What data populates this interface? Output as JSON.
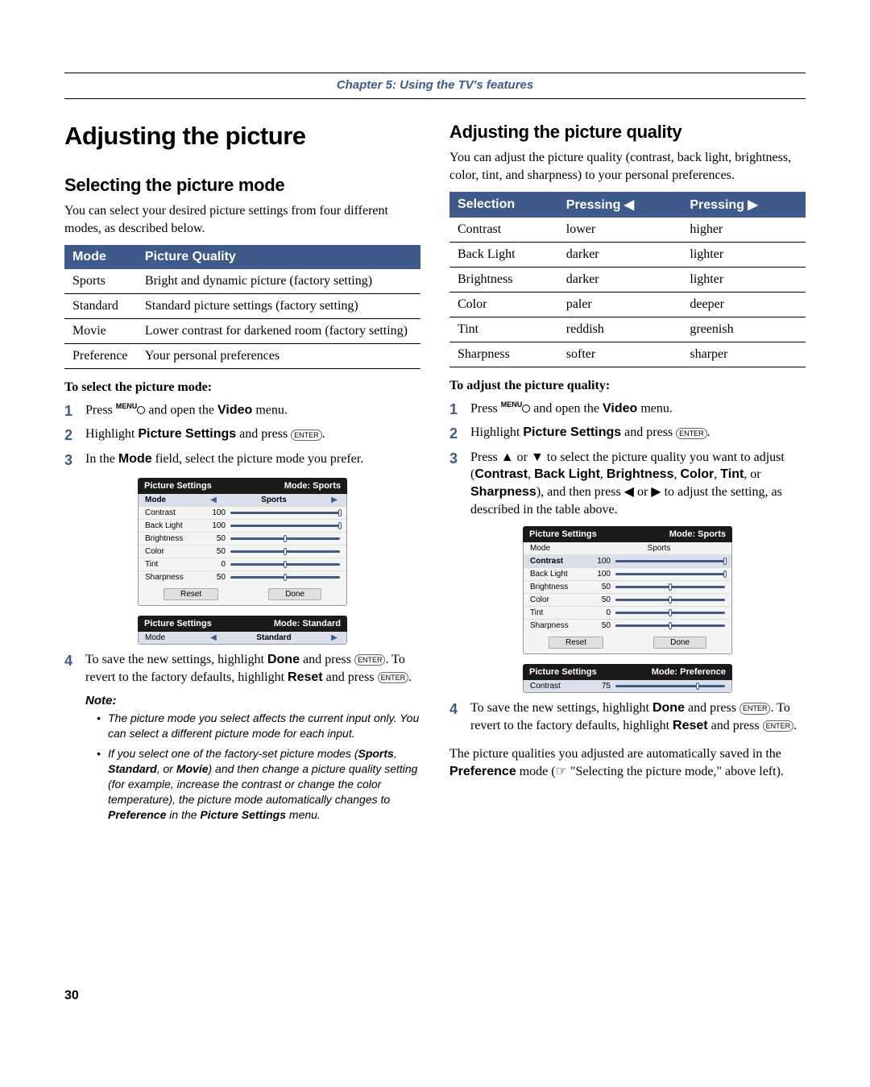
{
  "chapter": "Chapter 5: Using the TV's features",
  "left": {
    "h1": "Adjusting the picture",
    "h2": "Selecting the picture mode",
    "intro": "You can select your desired picture settings from four different modes, as described below.",
    "table": {
      "head1": "Mode",
      "head2": "Picture Quality",
      "rows": [
        {
          "c1": "Sports",
          "c2": "Bright and dynamic picture (factory setting)"
        },
        {
          "c1": "Standard",
          "c2": "Standard picture settings (factory setting)"
        },
        {
          "c1": "Movie",
          "c2": "Lower contrast for darkened room (factory setting)"
        },
        {
          "c1": "Preference",
          "c2": "Your personal preferences"
        }
      ]
    },
    "instr_head": "To select the picture mode:",
    "s1a": "Press ",
    "s1_menu": "MENU",
    "s1b": " and open the ",
    "s1_video": "Video",
    "s1c": " menu.",
    "s2a": "Highlight ",
    "s2_ps": "Picture Settings",
    "s2b": " and press ",
    "s2_enter": "ENTER",
    "s2c": ".",
    "s3a": "In the ",
    "s3_mode": "Mode",
    "s3b": " field, select the picture mode you prefer.",
    "menu1": {
      "title_l": "Picture Settings",
      "title_r": "Mode: Sports",
      "mode_label": "Mode",
      "mode_val": "Sports",
      "rows": [
        {
          "lbl": "Contrast",
          "val": "100",
          "pos": 100
        },
        {
          "lbl": "Back Light",
          "val": "100",
          "pos": 100
        },
        {
          "lbl": "Brightness",
          "val": "50",
          "pos": 50
        },
        {
          "lbl": "Color",
          "val": "50",
          "pos": 50
        },
        {
          "lbl": "Tint",
          "val": "0",
          "pos": 50
        },
        {
          "lbl": "Sharpness",
          "val": "50",
          "pos": 50
        }
      ],
      "reset": "Reset",
      "done": "Done",
      "mini_l": "Picture Settings",
      "mini_r": "Mode: Standard",
      "mini_mode_lbl": "Mode",
      "mini_mode_val": "Standard"
    },
    "s4a": "To save the new settings, highlight ",
    "s4_done": "Done",
    "s4b": " and press ",
    "s4_enter": "ENTER",
    "s4c": ". To revert to the factory defaults, highlight ",
    "s4_reset": "Reset",
    "s4d": " and press ",
    "s4_enter2": "ENTER",
    "s4e": ".",
    "note_head": "Note:",
    "note1": "The picture mode you select affects the current input only. You can select a different picture mode for each input.",
    "note2a": "If you select one of the factory-set picture modes (",
    "note2_sports": "Sports",
    "note2_sep1": ", ",
    "note2_standard": "Standard",
    "note2_sep2": ", or ",
    "note2_movie": "Movie",
    "note2b": ") and then change a picture quality setting (for example, increase the contrast or change the color temperature), the picture mode automatically changes to ",
    "note2_pref": "Preference",
    "note2c": " in the ",
    "note2_ps": "Picture Settings",
    "note2d": " menu."
  },
  "right": {
    "h2": "Adjusting the picture quality",
    "intro": "You can adjust the picture quality (contrast, back light, brightness, color, tint, and sharpness) to your personal preferences.",
    "table": {
      "head1": "Selection",
      "head2": "Pressing ◀",
      "head3": "Pressing ▶",
      "rows": [
        {
          "c1": "Contrast",
          "c2": "lower",
          "c3": "higher"
        },
        {
          "c1": "Back Light",
          "c2": "darker",
          "c3": "lighter"
        },
        {
          "c1": "Brightness",
          "c2": "darker",
          "c3": "lighter"
        },
        {
          "c1": "Color",
          "c2": "paler",
          "c3": "deeper"
        },
        {
          "c1": "Tint",
          "c2": "reddish",
          "c3": "greenish"
        },
        {
          "c1": "Sharpness",
          "c2": "softer",
          "c3": "sharper"
        }
      ]
    },
    "instr_head": "To adjust the picture quality:",
    "s1a": "Press ",
    "s1_menu": "MENU",
    "s1b": " and open the ",
    "s1_video": "Video",
    "s1c": " menu.",
    "s2a": "Highlight ",
    "s2_ps": "Picture Settings",
    "s2b": " and press ",
    "s2_enter": "ENTER",
    "s2c": ".",
    "s3a": "Press ▲ or ▼ to select the picture quality you want to adjust (",
    "s3_c": "Contrast",
    "s3s1": ", ",
    "s3_bl": "Back Light",
    "s3s2": ", ",
    "s3_br": "Brightness",
    "s3s3": ", ",
    "s3_co": "Color",
    "s3s4": ", ",
    "s3_ti": "Tint",
    "s3s5": ", or ",
    "s3_sh": "Sharpness",
    "s3b": "), and then press ◀ or ▶ to adjust the setting, as described in the table above.",
    "menu2": {
      "title_l": "Picture Settings",
      "title_r": "Mode: Sports",
      "mode_label": "Mode",
      "mode_val": "Sports",
      "rows": [
        {
          "lbl": "Contrast",
          "val": "100",
          "pos": 100,
          "sel": true
        },
        {
          "lbl": "Back Light",
          "val": "100",
          "pos": 100
        },
        {
          "lbl": "Brightness",
          "val": "50",
          "pos": 50
        },
        {
          "lbl": "Color",
          "val": "50",
          "pos": 50
        },
        {
          "lbl": "Tint",
          "val": "0",
          "pos": 50
        },
        {
          "lbl": "Sharpness",
          "val": "50",
          "pos": 50
        }
      ],
      "reset": "Reset",
      "done": "Done",
      "mini_l": "Picture Settings",
      "mini_r": "Mode: Preference",
      "mini_row_lbl": "Contrast",
      "mini_row_val": "75"
    },
    "s4a": "To save the new settings, highlight ",
    "s4_done": "Done",
    "s4b": " and press ",
    "s4_enter": "ENTER",
    "s4c": ". To revert to the factory defaults, highlight ",
    "s4_reset": "Reset",
    "s4d": " and press ",
    "s4_enter2": "ENTER",
    "s4e": ".",
    "post_a": "The picture qualities you adjusted are automatically saved in the ",
    "post_pref": "Preference",
    "post_b": " mode (☞ \"Selecting the picture mode,\" above left)."
  },
  "page": "30"
}
